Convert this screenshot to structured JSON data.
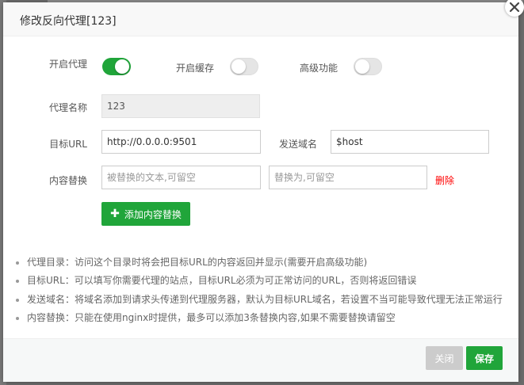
{
  "dialog": {
    "title": "修改反向代理[123]",
    "close_icon": "close-icon"
  },
  "toggles": {
    "proxy_label": "开启代理",
    "proxy_on": true,
    "cache_label": "开启缓存",
    "cache_on": false,
    "advanced_label": "高级功能",
    "advanced_on": false
  },
  "form": {
    "name_label": "代理名称",
    "name_value": "123",
    "url_label": "目标URL",
    "url_value": "http://0.0.0.0:9501",
    "domain_label": "发送域名",
    "domain_value": "$host",
    "replace_label": "内容替换",
    "replace_from_placeholder": "被替换的文本,可留空",
    "replace_to_placeholder": "替换为,可留空",
    "delete_label": "删除",
    "add_replace_label": "添加内容替换"
  },
  "notes": [
    "代理目录：访问这个目录时将会把目标URL的内容返回并显示(需要开启高级功能)",
    "目标URL：可以填写你需要代理的站点，目标URL必须为可正常访问的URL，否则将返回错误",
    "发送域名：将域名添加到请求头传递到代理服务器，默认为目标URL域名，若设置不当可能导致代理无法正常运行",
    "内容替换：只能在使用nginx时提供，最多可以添加3条替换内容,如果不需要替换请留空"
  ],
  "footer": {
    "close_label": "关闭",
    "save_label": "保存"
  },
  "colors": {
    "accent": "#20a53a",
    "danger": "#ff0000",
    "disabled_button": "#cccccc"
  }
}
